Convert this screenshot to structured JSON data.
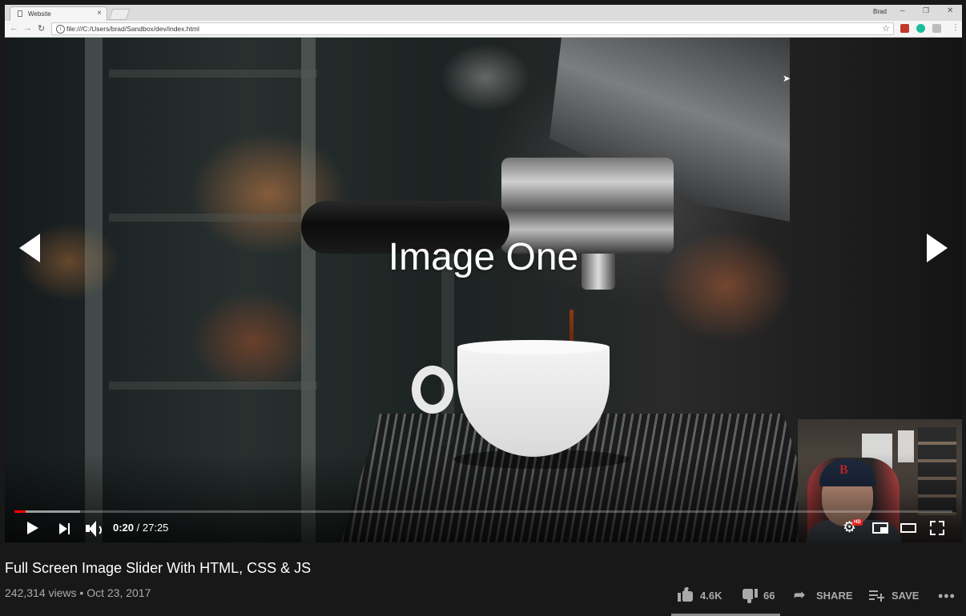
{
  "browser": {
    "tab_title": "Website",
    "tab_close": "×",
    "window_label": "Brad",
    "window_buttons": {
      "minimize": "–",
      "restore": "❐",
      "close": "✕"
    },
    "nav": {
      "back": "←",
      "forward": "→",
      "reload": "↻"
    },
    "url": "file:///C:/Users/brad/Sandbox/dev/index.html",
    "bookmark_star": "☆",
    "menu": "⋮",
    "extension_colors": [
      "#c0392b",
      "#1abc9c",
      "#bdbdbd"
    ]
  },
  "slider": {
    "caption": "Image One",
    "prev_arrow": "previous-slide",
    "next_arrow": "next-slide"
  },
  "player": {
    "current_time": "0:20",
    "separator": " / ",
    "duration": "27:25",
    "progress_played": 0.012,
    "progress_loaded": 0.07,
    "hd_badge": "HD",
    "settings_icon": "⚙",
    "accent_color": "#ff0000"
  },
  "video": {
    "title": "Full Screen Image Slider With HTML, CSS & JS",
    "views": "242,314 views",
    "dot": "•",
    "date": "Oct 23, 2017"
  },
  "actions": {
    "likes": "4.6K",
    "dislikes": "66",
    "share": "SHARE",
    "save": "SAVE",
    "more": "•••"
  }
}
